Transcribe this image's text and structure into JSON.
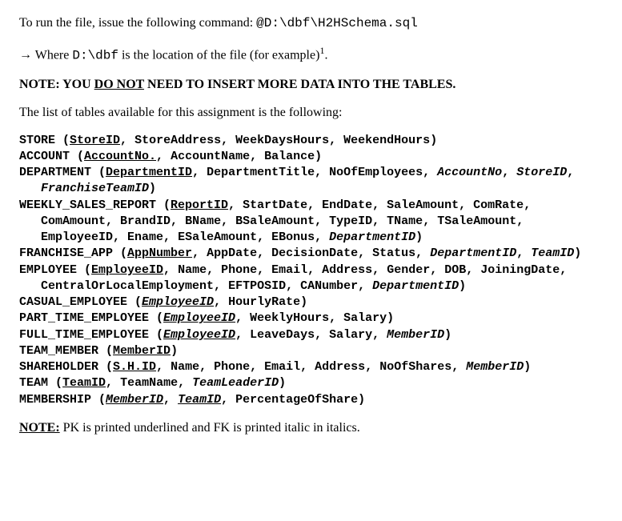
{
  "intro": {
    "run_text": "To run the file, issue the following command: ",
    "run_command": "@D:\\dbf\\H2HSchema.sql",
    "where_arrow": "→",
    "where_prefix": " Where ",
    "where_path": "D:\\dbf",
    "where_suffix": " is the location of the file (for example)",
    "footnote_mark": "1",
    "where_period": "."
  },
  "note1": {
    "prefix": "NOTE: YOU ",
    "do_not": "DO NOT",
    "suffix": " NEED TO INSERT MORE DATA INTO THE TABLES."
  },
  "tables_intro": "The list of tables available for this assignment is the following:",
  "schema": {
    "store": {
      "name": "STORE",
      "cols": {
        "c0": "StoreID",
        "c1": "StoreAddress",
        "c2": "WeekDaysHours",
        "c3": "WeekendHours"
      }
    },
    "account": {
      "name": "ACCOUNT",
      "cols": {
        "c0": "AccountNo.",
        "c1": "AccountName",
        "c2": "Balance"
      }
    },
    "department": {
      "name": "DEPARTMENT",
      "cols": {
        "c0": "DepartmentID",
        "c1": "DepartmentTitle",
        "c2": "NoOfEmployees",
        "c3": "AccountNo",
        "c4": "StoreID",
        "c5": "FranchiseTeamID"
      }
    },
    "wsr": {
      "name": "WEEKLY_SALES_REPORT",
      "cols": {
        "c0": "ReportID",
        "c1": "StartDate",
        "c2": "EndDate",
        "c3": "SaleAmount",
        "c4": "ComRate",
        "c5": "ComAmount",
        "c6": "BrandID",
        "c7": "BName",
        "c8": "BSaleAmount",
        "c9": "TypeID",
        "c10": "TName",
        "c11": "TSaleAmount",
        "c12": "EmployeeID",
        "c13": "Ename",
        "c14": "ESaleAmount",
        "c15": "EBonus",
        "c16": "DepartmentID"
      }
    },
    "franchise_app": {
      "name": "FRANCHISE_APP",
      "cols": {
        "c0": "AppNumber",
        "c1": "AppDate",
        "c2": "DecisionDate",
        "c3": "Status",
        "c4": "DepartmentID",
        "c5": "TeamID"
      }
    },
    "employee": {
      "name": "EMPLOYEE",
      "cols": {
        "c0": "EmployeeID",
        "c1": "Name",
        "c2": "Phone",
        "c3": "Email",
        "c4": "Address",
        "c5": "Gender",
        "c6": "DOB",
        "c7": "JoiningDate",
        "c8": "CentralOrLocalEmployment",
        "c9": "EFTPOSID",
        "c10": "CANumber",
        "c11": "DepartmentID"
      }
    },
    "casual": {
      "name": "CASUAL_EMPLOYEE",
      "cols": {
        "c0": "EmployeeID",
        "c1": "HourlyRate"
      }
    },
    "part_time": {
      "name": "PART_TIME_EMPLOYEE",
      "cols": {
        "c0": "EmployeeID",
        "c1": "WeeklyHours",
        "c2": "Salary"
      }
    },
    "full_time": {
      "name": "FULL_TIME_EMPLOYEE",
      "cols": {
        "c0": "EmployeeID",
        "c1": "LeaveDays",
        "c2": "Salary",
        "c3": "MemberID"
      }
    },
    "team_member": {
      "name": "TEAM_MEMBER",
      "cols": {
        "c0": "MemberID"
      }
    },
    "shareholder": {
      "name": "SHAREHOLDER",
      "cols": {
        "c0": "S.H.ID",
        "c1": "Name",
        "c2": "Phone",
        "c3": "Email",
        "c4": "Address",
        "c5": "NoOfShares",
        "c6": "MemberID"
      }
    },
    "team": {
      "name": "TEAM",
      "cols": {
        "c0": "TeamID",
        "c1": "TeamName",
        "c2": "TeamLeaderID"
      }
    },
    "membership": {
      "name": "MEMBERSHIP",
      "cols": {
        "c0": "MemberID",
        "c1": "TeamID",
        "c2": "PercentageOfShare"
      }
    }
  },
  "note2": {
    "label": "NOTE:",
    "text": " PK is printed underlined and FK is printed italic in italics."
  }
}
